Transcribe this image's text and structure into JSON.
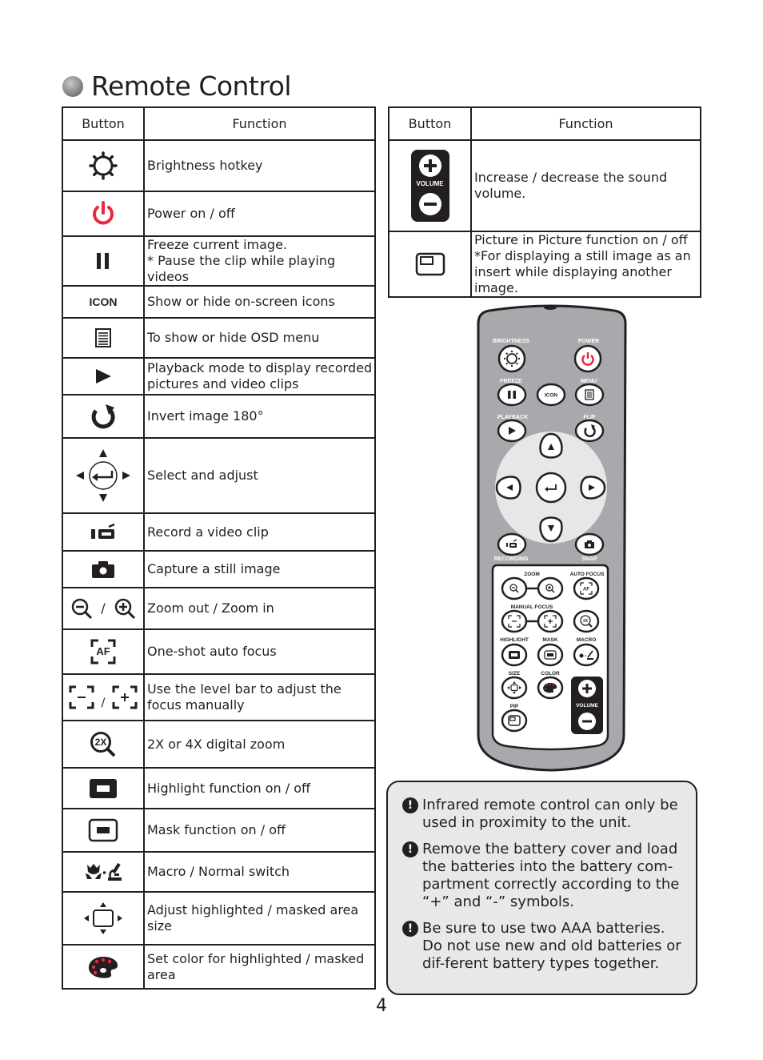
{
  "page": {
    "title": "Remote Control",
    "page_number": "4"
  },
  "table_left": {
    "header_button": "Button",
    "header_function": "Function",
    "rows": [
      {
        "icon": "brightness-icon",
        "function": "Brightness hotkey"
      },
      {
        "icon": "power-icon",
        "function": "Power on / off"
      },
      {
        "icon": "pause-icon",
        "function": "Freeze current image.\n* Pause the clip while playing videos"
      },
      {
        "icon": "icon-text-icon",
        "icon_text": "ICON",
        "function": "Show or hide on-screen icons"
      },
      {
        "icon": "menu-icon",
        "function": "To show or hide OSD menu"
      },
      {
        "icon": "play-icon",
        "function": "Playback mode to display recorded pictures and video clips"
      },
      {
        "icon": "rotate-icon",
        "function": "Invert image 180°"
      },
      {
        "icon": "navigation-pad-icon",
        "function": "Select and adjust"
      },
      {
        "icon": "video-camera-icon",
        "function": "Record a video clip"
      },
      {
        "icon": "camera-icon",
        "function": "Capture a still image"
      },
      {
        "icon": "zoom-out-in-icon",
        "icon_text": "/",
        "function": "Zoom out / Zoom in"
      },
      {
        "icon": "auto-focus-icon",
        "icon_text": "AF",
        "function": "One-shot auto focus"
      },
      {
        "icon": "manual-focus-icon",
        "icon_text": "/",
        "function": "Use the level bar to adjust the focus manually"
      },
      {
        "icon": "digital-zoom-icon",
        "icon_text": "2X",
        "function": "2X or 4X digital zoom"
      },
      {
        "icon": "highlight-icon",
        "function": "Highlight function on / off"
      },
      {
        "icon": "mask-icon",
        "function": "Mask function on / off"
      },
      {
        "icon": "macro-normal-icon",
        "function": "Macro / Normal switch"
      },
      {
        "icon": "resize-area-icon",
        "function": "Adjust highlighted / masked area size"
      },
      {
        "icon": "color-palette-icon",
        "function": "Set color for highlighted / masked area"
      }
    ]
  },
  "table_right": {
    "header_button": "Button",
    "header_function": "Function",
    "rows": [
      {
        "icon": "volume-icon",
        "icon_text": "VOLUME",
        "function": "Increase / decrease the sound volume."
      },
      {
        "icon": "pip-icon",
        "function": "Picture in Picture function on / off  *For displaying a still image as an insert while displaying another image."
      }
    ]
  },
  "remote": {
    "labels": {
      "brightness": "BRIGHTNESS",
      "power": "POWER",
      "freeze": "FREEZE",
      "icon": "ICON",
      "menu": "MENU",
      "playback": "PLAYBACK",
      "flip": "FLIP",
      "recording": "RECORDING",
      "snap": "SNAP",
      "zoom": "ZOOM",
      "auto_focus": "AUTO FOCUS",
      "manual_focus": "MANUAL FOCUS",
      "highlight": "HIGHLIGHT",
      "mask": "MASK",
      "macro": "MACRO",
      "size": "SIZE",
      "color": "COLOR",
      "pip": "PIP",
      "volume": "VOLUME",
      "af": "AF",
      "twox": "2X"
    }
  },
  "notes": [
    "Infrared remote control can only be used in proximity to the unit.",
    "Remove the battery cover and load the batteries into the battery com-partment correctly according to the “+” and “-” symbols.",
    "Be sure to use two AAA batteries. Do not use new and old batteries or dif-ferent battery types together."
  ],
  "colors": {
    "accent_red": "#e8283c",
    "remote_body": "#a7a9ac",
    "panel_bg": "#e8e8e8",
    "ink": "#231f20"
  }
}
